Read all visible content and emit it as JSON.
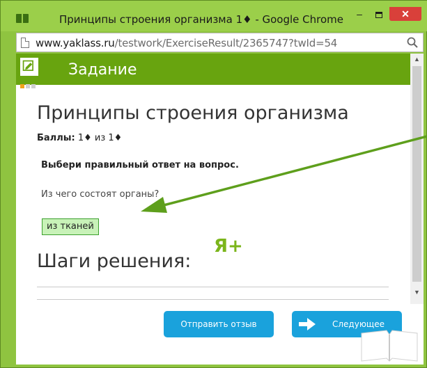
{
  "window": {
    "title": "Принципы строения организма 1♦ - Google Chrome",
    "controls": {
      "minimize": "–",
      "close": "✕"
    }
  },
  "address_bar": {
    "host": "www.yaklass.ru",
    "path": "/testwork/ExerciseResult/2365747?twId=54"
  },
  "header": {
    "title": "Задание"
  },
  "task": {
    "title": "Принципы строения организма",
    "score_label": "Баллы:",
    "score_value": "1♦ из 1♦",
    "instruction": "Выбери правильный ответ на вопрос.",
    "question": "Из чего состоят органы?",
    "answer": "из тканей"
  },
  "brand_badge": "Я+",
  "steps": {
    "title": "Шаги решения:"
  },
  "buttons": {
    "feedback": "Отправить отзыв",
    "next": "Следующее"
  },
  "colors": {
    "header_green": "#68a40f",
    "button_blue": "#1aa2dc",
    "answer_bg": "#c8f2b8",
    "annotation_arrow": "#5e9f1c"
  }
}
